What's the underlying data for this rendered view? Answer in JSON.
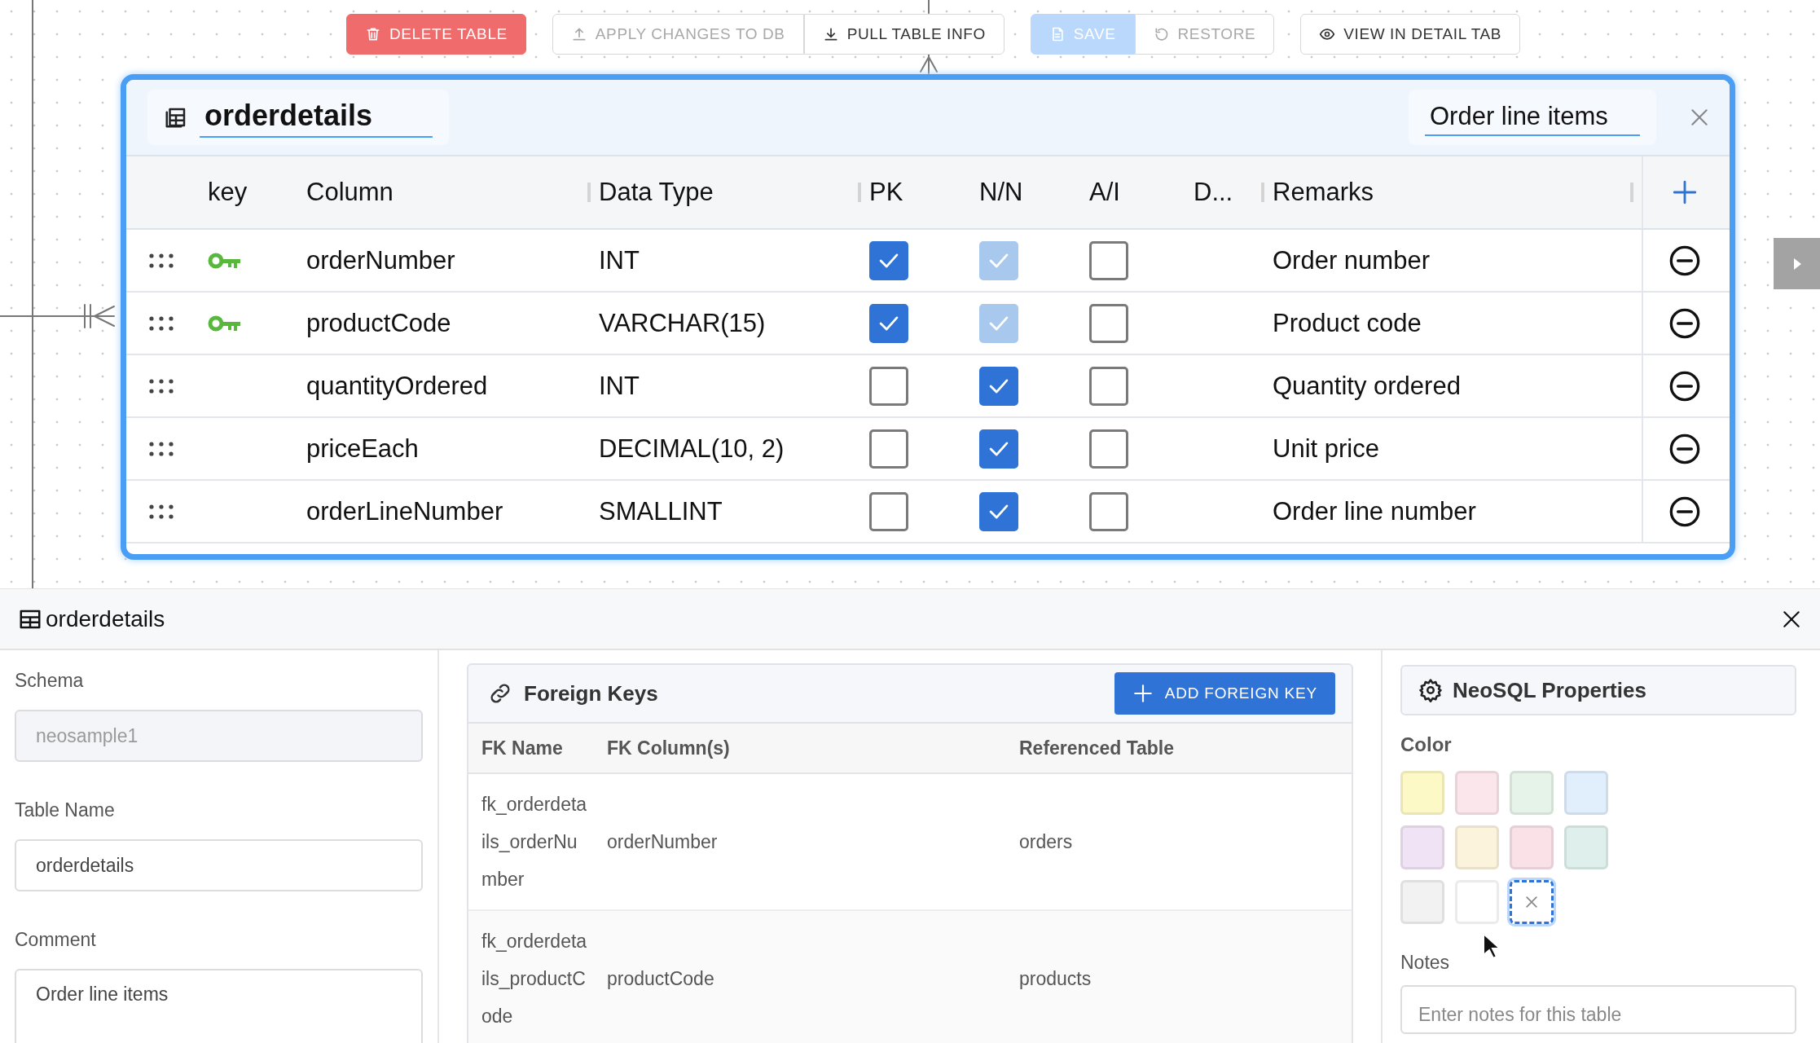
{
  "toolbar": [
    [
      {
        "label": "DELETE TABLE",
        "kind": "danger",
        "disabled": false
      }
    ],
    [
      {
        "label": "APPLY CHANGES TO DB",
        "kind": "outline",
        "disabled": true
      },
      {
        "label": "PULL TABLE INFO",
        "kind": "outline",
        "disabled": false
      }
    ],
    [
      {
        "label": "SAVE",
        "kind": "primary",
        "disabled": true
      },
      {
        "label": "RESTORE",
        "kind": "outline",
        "disabled": true
      }
    ],
    [
      {
        "label": "VIEW IN DETAIL TAB",
        "kind": "outline",
        "disabled": false
      }
    ]
  ],
  "table": {
    "title": "orderdetails",
    "comment": "Order line items",
    "columns": [
      "key",
      "Column",
      "Data Type",
      "PK",
      "N/N",
      "A/I",
      "D...",
      "Remarks"
    ],
    "rows": [
      {
        "key": true,
        "column": "orderNumber",
        "data_type": "INT",
        "pk": true,
        "nn": true,
        "nn_disabled": true,
        "ai": false,
        "remarks": "Order number"
      },
      {
        "key": true,
        "column": "productCode",
        "data_type": "VARCHAR(15)",
        "pk": true,
        "nn": true,
        "nn_disabled": true,
        "ai": false,
        "remarks": "Product code"
      },
      {
        "key": false,
        "column": "quantityOrdered",
        "data_type": "INT",
        "pk": false,
        "nn": true,
        "nn_disabled": false,
        "ai": false,
        "remarks": "Quantity ordered"
      },
      {
        "key": false,
        "column": "priceEach",
        "data_type": "DECIMAL(10, 2)",
        "pk": false,
        "nn": true,
        "nn_disabled": false,
        "ai": false,
        "remarks": "Unit price"
      },
      {
        "key": false,
        "column": "orderLineNumber",
        "data_type": "SMALLINT",
        "pk": false,
        "nn": true,
        "nn_disabled": false,
        "ai": false,
        "remarks": "Order line number"
      }
    ]
  },
  "details": {
    "title": "orderdetails",
    "fields": [
      {
        "label": "Schema",
        "value": "neosample1",
        "kind": "text",
        "disabled": true
      },
      {
        "label": "Table Name",
        "value": "orderdetails",
        "kind": "text",
        "disabled": false
      },
      {
        "label": "Comment",
        "value": "Order line items",
        "kind": "textarea",
        "disabled": false
      }
    ],
    "foreign_keys": {
      "title": "Foreign Keys",
      "button": "ADD FOREIGN KEY",
      "columns": [
        "FK Name",
        "FK Column(s)",
        "Referenced Table"
      ],
      "rows": [
        {
          "name": "fk_orderdetails_orderNumber",
          "columns": "orderNumber",
          "referenced": "orders"
        },
        {
          "name": "fk_orderdetails_productCode",
          "columns": "productCode",
          "referenced": "products"
        }
      ]
    },
    "properties": {
      "title": "NeoSQL Properties",
      "color_label": "Color",
      "swatches": [
        {
          "kind": "color",
          "color": "#fdf9c6",
          "selected": false
        },
        {
          "kind": "color",
          "color": "#fbe6ec",
          "selected": false
        },
        {
          "kind": "color",
          "color": "#e6f3e8",
          "selected": false
        },
        {
          "kind": "color",
          "color": "#e1eefc",
          "selected": false
        },
        {
          "kind": "color",
          "color": "#f1e3f6",
          "selected": false
        },
        {
          "kind": "color",
          "color": "#fcf3dc",
          "selected": false
        },
        {
          "kind": "color",
          "color": "#fae1e7",
          "selected": false
        },
        {
          "kind": "color",
          "color": "#dff0ec",
          "selected": false
        },
        {
          "kind": "color",
          "color": "#f2f2f2",
          "selected": false
        },
        {
          "kind": "color",
          "color": "#ffffff",
          "selected": false
        },
        {
          "kind": "none",
          "selected": true
        }
      ],
      "notes_label": "Notes",
      "notes_placeholder": "Enter notes for this table"
    }
  }
}
